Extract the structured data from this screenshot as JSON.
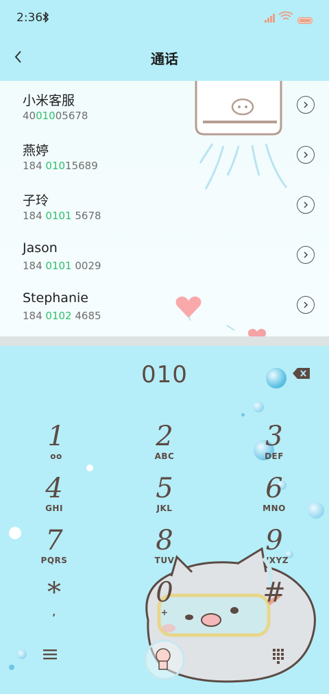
{
  "status_bar": {
    "time": "2:36",
    "icons": [
      "bluetooth-icon",
      "signal-icon",
      "wifi-icon",
      "battery-icon"
    ]
  },
  "header": {
    "title": "通话",
    "back_icon": "chevron-left-icon"
  },
  "contacts": [
    {
      "name": "小米客服",
      "number_pre": "40",
      "number_match": "010",
      "number_post": "05678"
    },
    {
      "name": "燕婷",
      "number_pre": "184 ",
      "number_match": "010",
      "number_post": "15689"
    },
    {
      "name": "子玲",
      "number_pre": "184 ",
      "number_match": "0101",
      "number_post": " 5678"
    },
    {
      "name": "Jason",
      "number_pre": "184 ",
      "number_match": "0101",
      "number_post": " 0029"
    },
    {
      "name": "Stephanie",
      "number_pre": "184 ",
      "number_match": "0102",
      "number_post": " 4685"
    }
  ],
  "dialer": {
    "input": "010",
    "keys": [
      {
        "digit": "1",
        "sub": "oo"
      },
      {
        "digit": "2",
        "sub": "ABC"
      },
      {
        "digit": "3",
        "sub": "DEF"
      },
      {
        "digit": "4",
        "sub": "GHI"
      },
      {
        "digit": "5",
        "sub": "JKL"
      },
      {
        "digit": "6",
        "sub": "MNO"
      },
      {
        "digit": "7",
        "sub": "PQRS"
      },
      {
        "digit": "8",
        "sub": "TUV"
      },
      {
        "digit": "9",
        "sub": "WXYZ"
      },
      {
        "digit": "*",
        "sub": ","
      },
      {
        "digit": "0",
        "sub": "+"
      },
      {
        "digit": "#",
        "sub": ""
      }
    ]
  },
  "colors": {
    "background": "#b5eef8",
    "list_background": "#f4fdfe",
    "match_highlight": "#2ebf6a",
    "digit_color": "#5c4a44"
  }
}
